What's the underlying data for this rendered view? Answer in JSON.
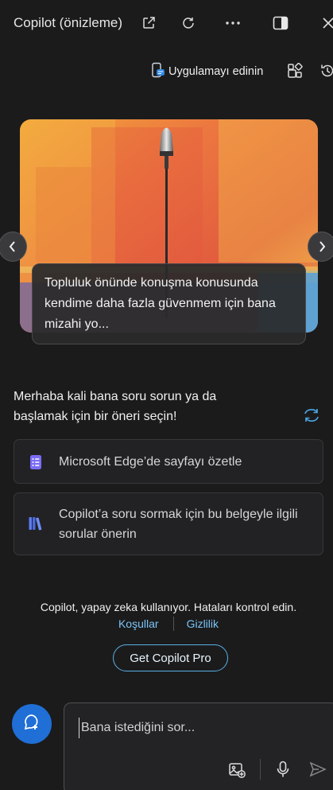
{
  "window": {
    "title": "Copilot (önizleme)"
  },
  "header_row": {
    "get_app_label": "Uygulamayı edinin"
  },
  "hero": {
    "caption": "Topluluk önünde konuşma konusunda kendime daha fazla güvenmem için bana mizahi yo..."
  },
  "greeting": {
    "text": "Merhaba kali bana soru sorun ya da başlamak için bir öneri seçin!"
  },
  "suggestions": [
    {
      "label": "Microsoft Edge’de sayfayı özetle",
      "icon": "document-list-icon",
      "color": "#7b6cf6"
    },
    {
      "label": "Copilot’a soru sormak için bu belgeyle ilgili sorular önerin",
      "icon": "books-icon",
      "color": "#5b7cf0"
    }
  ],
  "footer": {
    "disclaimer": "Copilot, yapay zeka kullanıyor. Hataları kontrol edin.",
    "terms_link": "Koşullar",
    "privacy_link": "Gizlilik",
    "pro_button": "Get Copilot Pro"
  },
  "composer": {
    "placeholder": "Bana istediğini sor..."
  },
  "colors": {
    "background": "#1b1b1c",
    "accent": "#1f6fd6",
    "link": "#7cc4f5"
  }
}
